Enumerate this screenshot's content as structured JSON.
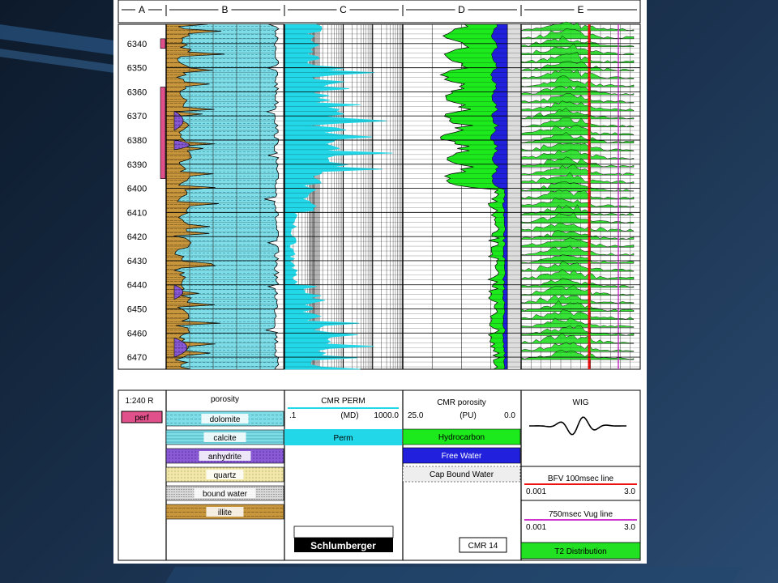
{
  "columns": [
    "A",
    "B",
    "C",
    "D",
    "E"
  ],
  "depths": [
    6340,
    6350,
    6360,
    6370,
    6380,
    6390,
    6400,
    6410,
    6420,
    6430,
    6440,
    6450,
    6460,
    6470
  ],
  "colors": {
    "porosity": "#7fdde8",
    "illite": "#c8963c",
    "anhydrite": "#8a5ad6",
    "quartz": "#f1e7a8",
    "bound_water": "#d8d8d8",
    "perm": "#22d8e8",
    "hydrocarbon": "#1cea1c",
    "free_water": "#2020dd",
    "cap_bound_water": "#eeeeee",
    "t2": "#22e022",
    "perf": "#e0508a",
    "red_line": "#ee1111",
    "magenta_line": "#cc33cc"
  },
  "legend": {
    "A": {
      "scale": "1:240 R",
      "perf": "perf"
    },
    "B": {
      "title": "porosity",
      "items": [
        "dolomite",
        "calcite",
        "anhydrite",
        "quartz",
        "bound water",
        "illite"
      ]
    },
    "C": {
      "title": "CMR PERM",
      "min": ".1",
      "unit": "(MD)",
      "max": "1000.0",
      "swatch": "Perm",
      "brand": "Schlumberger"
    },
    "D": {
      "title": "CMR porosity",
      "left": "25.0",
      "unit": "(PU)",
      "right": "0.0",
      "items": [
        "Hydrocarbon",
        "Free Water",
        "Cap Bound Water"
      ],
      "tag": "CMR 14"
    },
    "E": {
      "title": "WIG",
      "line1": {
        "label": "BFV 100msec line",
        "min": "0.001",
        "max": "3.0"
      },
      "line2": {
        "label": "750msec Vug line",
        "min": "0.001",
        "max": "3.0"
      },
      "swatch": "T2 Distribution"
    }
  },
  "chart_data": {
    "type": "area",
    "title": "",
    "ylabel": "",
    "y_range": [
      6332,
      6475
    ],
    "y_ticks": [
      6340,
      6350,
      6360,
      6370,
      6380,
      6390,
      6400,
      6410,
      6420,
      6430,
      6440,
      6450,
      6460,
      6470
    ],
    "perf_intervals": [
      [
        6338,
        6342
      ],
      [
        6358,
        6396
      ]
    ],
    "tracks": [
      "porosity lithology",
      "CMR PERM",
      "CMR porosity",
      "T2 Distribution"
    ]
  }
}
